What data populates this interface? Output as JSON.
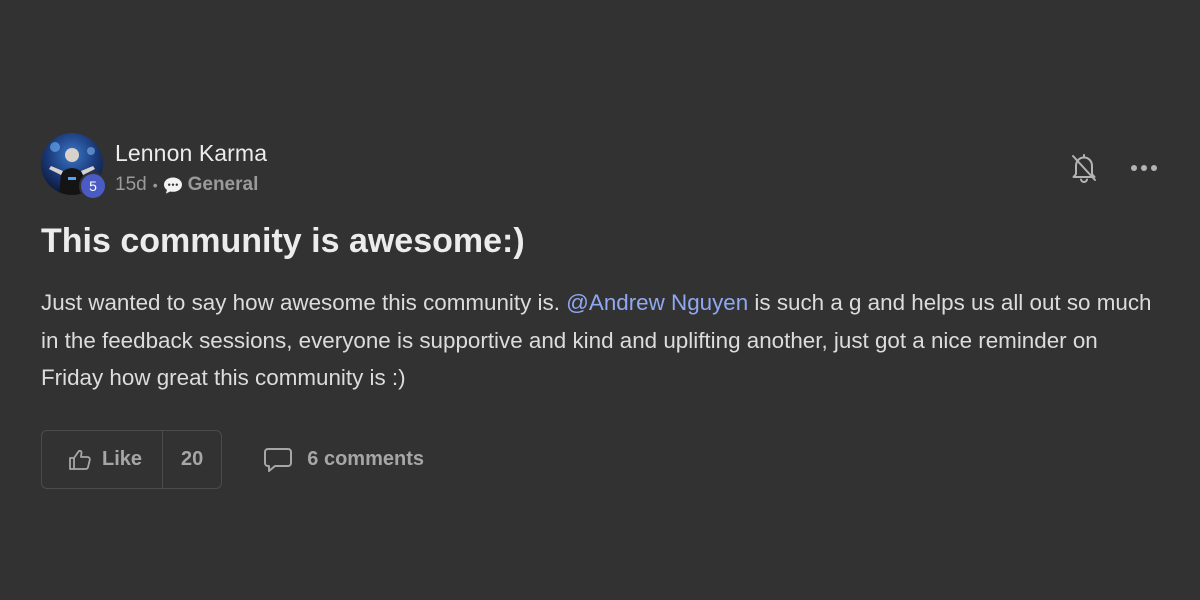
{
  "post": {
    "author": {
      "name": "Lennon Karma",
      "level": "5"
    },
    "time_ago": "15d",
    "separator": "•",
    "category": "General",
    "title": "This community is awesome:)",
    "body": {
      "before_mention": "Just wanted to say how awesome this community is. ",
      "mention": "@Andrew Nguyen",
      "after_mention": " is such a g and helps us all out so much in the feedback sessions, everyone is supportive and kind and uplifting another, just got a nice reminder on Friday how great this community is :)"
    },
    "actions": {
      "like_label": "Like",
      "like_count": "20",
      "comments_label": "6 comments"
    }
  },
  "icons": {
    "chat": "chat-bubble-icon",
    "bell": "bell-off-icon",
    "more": "more-horizontal-icon",
    "like": "thumbs-up-icon",
    "comment": "comment-icon"
  },
  "colors": {
    "background": "#323232",
    "mention": "#8fa8f0",
    "level_badge": "#4a5bc4"
  }
}
